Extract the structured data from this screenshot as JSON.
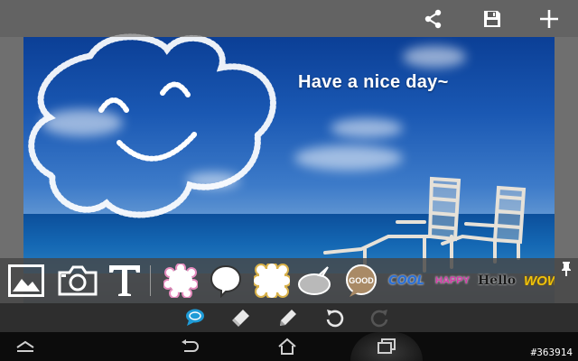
{
  "canvas": {
    "caption": "Have a nice day~"
  },
  "topbar": {
    "icons": [
      "share-icon",
      "save-icon",
      "add-icon"
    ]
  },
  "sticker_bar": {
    "tools": [
      "gallery-icon",
      "camera-icon",
      "text-tool-icon"
    ],
    "stickers": [
      {
        "name": "bubble-scalloped-pink"
      },
      {
        "name": "bubble-round-white"
      },
      {
        "name": "bubble-scalloped-yellow"
      },
      {
        "name": "bubble-oval-grey"
      },
      {
        "name": "bubble-good",
        "label": "GOOD"
      }
    ],
    "words": [
      {
        "text": "COOL",
        "color": "#2a6fd6"
      },
      {
        "text": "HAPPY",
        "color": "#d63aa8"
      },
      {
        "text": "Hello",
        "color": "#1a1a1a"
      },
      {
        "text": "WOW",
        "color": "#f0c20a"
      }
    ],
    "pin_icon": "pin-icon"
  },
  "edit_bar": {
    "icons": [
      "speech-bubble-icon",
      "eraser-icon",
      "pencil-icon",
      "undo-icon",
      "redo-icon"
    ],
    "accent": "#1e9bd7"
  },
  "navbar": {
    "icons": [
      "collapse-icon",
      "back-icon",
      "home-icon",
      "recent-apps-icon"
    ]
  },
  "watermark": "#363914"
}
